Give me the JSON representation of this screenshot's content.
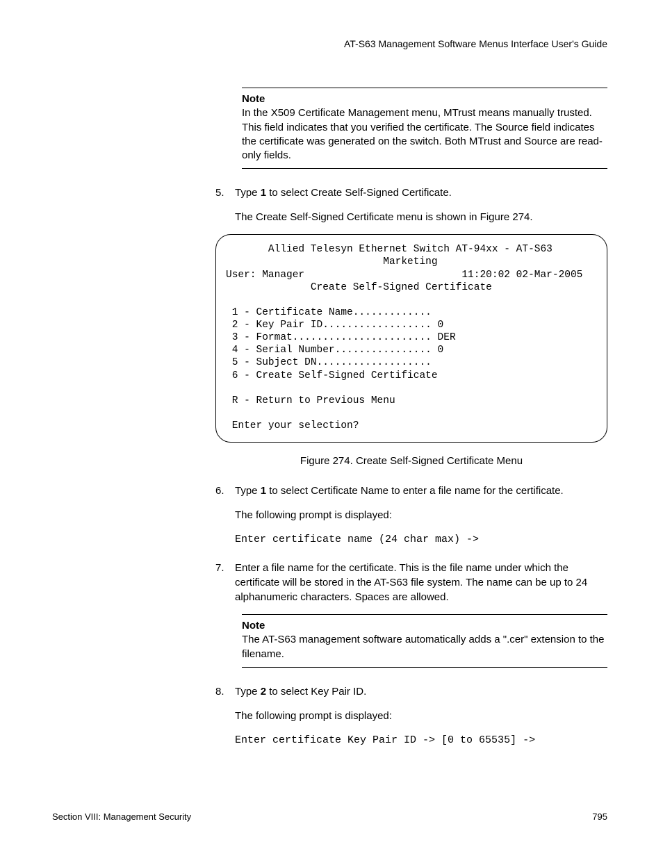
{
  "header": {
    "guide_title": "AT-S63 Management Software Menus Interface User's Guide"
  },
  "note1": {
    "label": "Note",
    "text": "In the X509 Certificate Management menu, MTrust means manually trusted. This field indicates that you verified the certificate. The Source field indicates the certificate was generated on the switch. Both MTrust and Source are read-only fields."
  },
  "step5": {
    "num": "5.",
    "pre": "Type ",
    "bold": "1",
    "post": " to select Create Self-Signed Certificate.",
    "after": "The Create Self-Signed Certificate menu is shown in Figure 274."
  },
  "terminal": {
    "line1": "       Allied Telesyn Ethernet Switch AT-94xx - AT-S63",
    "line2": "                          Marketing",
    "line3": "User: Manager                          11:20:02 02-Mar-2005",
    "line4": "              Create Self-Signed Certificate",
    "opt1": " 1 - Certificate Name.............",
    "opt2": " 2 - Key Pair ID.................. 0",
    "opt3": " 3 - Format....................... DER",
    "opt4": " 4 - Serial Number................ 0",
    "opt5": " 5 - Subject DN...................",
    "opt6": " 6 - Create Self-Signed Certificate",
    "optR": " R - Return to Previous Menu",
    "prompt": " Enter your selection?"
  },
  "caption": "Figure 274. Create Self-Signed Certificate Menu",
  "step6": {
    "num": "6.",
    "pre": "Type ",
    "bold": "1",
    "post": " to select Certificate Name to enter a file name for the certificate.",
    "after": "The following prompt is displayed:",
    "mono": "Enter certificate name (24 char max) ->"
  },
  "step7": {
    "num": "7.",
    "text": "Enter a file name for the certificate. This is the file name under which the certificate will be stored in the AT-S63 file system. The name can be up to 24 alphanumeric characters. Spaces are allowed."
  },
  "note2": {
    "label": "Note",
    "text": "The AT-S63 management software automatically adds a \".cer\" extension to the filename."
  },
  "step8": {
    "num": "8.",
    "pre": "Type ",
    "bold": "2",
    "post": " to select Key Pair ID.",
    "after": "The following prompt is displayed:",
    "mono": "Enter certificate Key Pair ID -> [0 to 65535] ->"
  },
  "footer": {
    "left": "Section VIII: Management Security",
    "right": "795"
  }
}
